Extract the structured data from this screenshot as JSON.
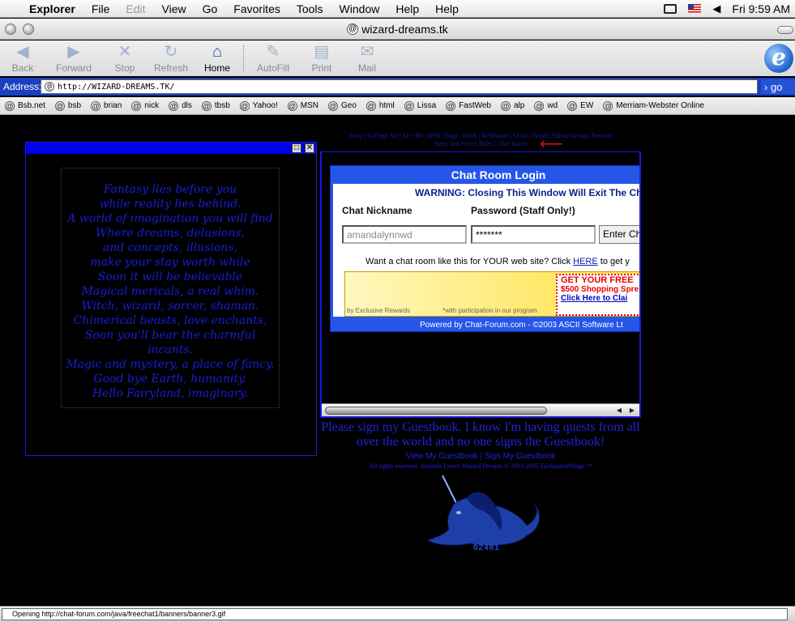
{
  "menubar": {
    "items": [
      "Explorer",
      "File",
      "Edit",
      "View",
      "Go",
      "Favorites",
      "Tools",
      "Window",
      "Help",
      "Help"
    ],
    "clock": "Fri 9:59 AM"
  },
  "window": {
    "title": "wizard-dreams.tk"
  },
  "toolbar": {
    "buttons": [
      "Back",
      "Forward",
      "Stop",
      "Refresh",
      "Home",
      "AutoFill",
      "Print",
      "Mail"
    ]
  },
  "address": {
    "label": "Address:",
    "url": "http://WIZARD-DREAMS.TK/",
    "go": "go"
  },
  "favorites": [
    "Bsb.net",
    "bsb",
    "brian",
    "nick",
    "dls",
    "tbsb",
    "Yahoo!",
    "MSN",
    "Geo",
    "html",
    "Lissa",
    "FastWeb",
    "alp",
    "wd",
    "EW",
    "Merriam-Webster Online"
  ],
  "poem": [
    "Fantasy lies before you",
    "while reality lies behind.",
    "A world of imagination you will find",
    "Where dreams, delusions,",
    "and concepts, illusions,",
    "make your stay worth while",
    "Soon it will be believable",
    "Magical mericals, a real whim.",
    "Witch, wizard, sorcer, shaman.",
    "Chimerical beasts, love enchants,",
    "Soon you'll bear the charmful incants.",
    "Magic and mystery, a place of fancy.",
    "Good bye Earth, humanity.",
    "Hello Fairyland, imaginary."
  ],
  "nav": {
    "line1": "Story | College Art | Art | Me | BSB | Bugs | Dolls | Bellmaker | Links | Email | Yahoo Group | Resumé",
    "line2": "Story and Novel Titles | Chat Room"
  },
  "chat": {
    "title": "Chat Room Login",
    "warning": "WARNING: Closing This Window Will Exit The Cha",
    "nickname_label": "Chat Nickname",
    "password_label": "Password (Staff Only!)",
    "nickname_value": "amandalynnwd",
    "password_value": "*******",
    "enter": "Enter Ch",
    "want_prefix": "Want a chat room like this for YOUR web site? Click",
    "here": "HERE",
    "want_suffix": "to get y",
    "banner": {
      "byline": "by Exclusive Rewards",
      "note": "*with participation in our program",
      "offer1": "GET YOUR FREE",
      "offer2": "$500 Shopping Spre",
      "offer3": "Click Here to Clai"
    },
    "powered": "Powered by Chat-Forum.com - ©2003 ASCII Software Lt"
  },
  "guestbook": {
    "message": "Please sign my Guestbook. I know I'm having quests from all over the world and no one signs the Guestbook!",
    "view": "View My Guestbook",
    "sign": "Sign My Guestbook",
    "rights": "All rights reserved. Amanda Lynn's Wizard Dreams © 2001-2005 EnchantedWings ™"
  },
  "counter": "02481",
  "status": "Opening http://chat-forum.com/java/freechat1/banners/banner3.gif",
  "colors": {
    "page_bg": "#000000",
    "link_blue": "#2222dd",
    "chat_header": "#2556e8",
    "arrow": "#e01010"
  }
}
